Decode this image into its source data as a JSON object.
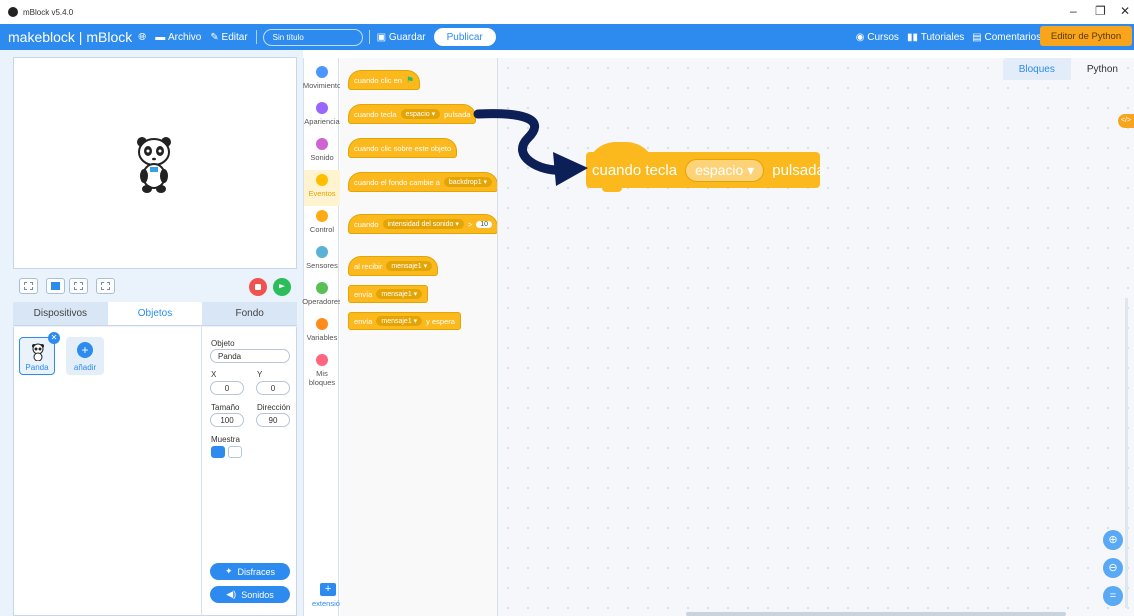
{
  "window": {
    "title": "mBlock v5.4.0",
    "controls": [
      "–",
      "❐",
      "✕"
    ]
  },
  "menubar": {
    "brand": "makeblock | mBlock",
    "file": "Archivo",
    "edit": "Editar",
    "title_placeholder": "Sin título",
    "save": "Guardar",
    "publish": "Publicar",
    "courses": "Cursos",
    "tutorials": "Tutoriales",
    "comments": "Comentarios",
    "more": "•••",
    "python_editor": "Editor de Python"
  },
  "panel_tabs": [
    "Dispositivos",
    "Objetos",
    "Fondo"
  ],
  "sprite": {
    "name": "Panda",
    "add": "añadir"
  },
  "props": {
    "object_label": "Objeto",
    "object_value": "Panda",
    "x_label": "X",
    "x_value": "0",
    "y_label": "Y",
    "y_value": "0",
    "size_label": "Tamaño",
    "size_value": "100",
    "direction_label": "Dirección",
    "direction_value": "90",
    "show_label": "Muestra"
  },
  "buttons": {
    "costumes": "Disfraces",
    "sounds": "Sonidos"
  },
  "categories": [
    {
      "label": "Movimiento",
      "color": "#4c97ff"
    },
    {
      "label": "Apariencia",
      "color": "#9966ff"
    },
    {
      "label": "Sonido",
      "color": "#cf63cf"
    },
    {
      "label": "Eventos",
      "color": "#ffbf00"
    },
    {
      "label": "Control",
      "color": "#ffab19"
    },
    {
      "label": "Sensores",
      "color": "#5cb1d6"
    },
    {
      "label": "Operadores",
      "color": "#59c059"
    },
    {
      "label": "Variables",
      "color": "#ff8c1a"
    },
    {
      "label": "Mis bloques",
      "color": "#ff6680"
    }
  ],
  "extension": "extensión",
  "blocks": {
    "b1": "cuando clic en",
    "b2_a": "cuando tecla",
    "b2_key": "espacio ▾",
    "b2_b": "pulsada",
    "b3": "cuando clic sobre este objeto",
    "b4_a": "cuando el fondo cambie a",
    "b4_dd": "backdrop1 ▾",
    "b5_a": "cuando",
    "b5_dd": "intensidad del sonido ▾",
    "b5_op": ">",
    "b5_num": "10",
    "b6_a": "al recibir",
    "b6_dd": "mensaje1 ▾",
    "b7_a": "envía",
    "b7_dd": "mensaje1 ▾",
    "b8_a": "envía",
    "b8_dd": "mensaje1 ▾",
    "b8_b": "y espera"
  },
  "workspace": {
    "tab_blocks": "Bloques",
    "tab_python": "Python",
    "code_chip": "</>",
    "big_block_a": "cuando tecla",
    "big_block_key": "espacio ▾",
    "big_block_b": "pulsada"
  },
  "colors": {
    "accent": "#2d8bf0",
    "events": "#fcb91e",
    "python_btn": "#f8a41c",
    "arrow": "#0c1f57"
  }
}
